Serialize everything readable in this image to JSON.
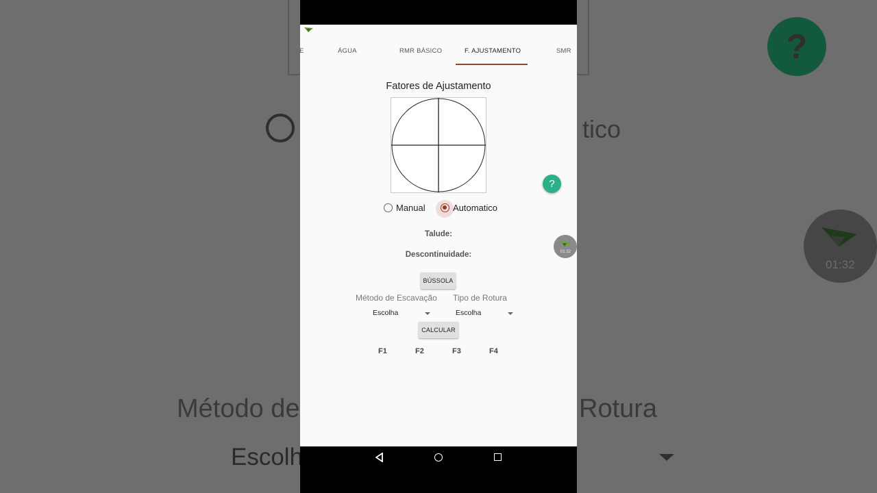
{
  "background": {
    "partial_right_text": "tico",
    "partial_label_left": "Método de",
    "partial_label_right": "Rotura",
    "partial_spinner": "Escolh",
    "help_glyph": "?",
    "recorder_time": "01:32"
  },
  "statusbar": {
    "app_icon": "paper-plane-icon"
  },
  "tabs": [
    {
      "label": "E"
    },
    {
      "label": "ÁGUA"
    },
    {
      "label": "RMR BÁSICO"
    },
    {
      "label": "F. AJUSTAMENTO",
      "active": true
    },
    {
      "label": "SMR"
    }
  ],
  "main": {
    "title": "Fatores de Ajustamento",
    "mode": {
      "options": [
        "Manual",
        "Automatico"
      ],
      "selected": "Automatico"
    },
    "talude_label": "Talude:",
    "descontinuidade_label": "Descontinuidade:",
    "bussola_button": "BÚSSOLA",
    "metodo_label": "Método de Escavação",
    "tipo_label": "Tipo de Rotura",
    "metodo_value": "Escolha",
    "tipo_value": "Escolha",
    "calcular_button": "CALCULAR",
    "factors": [
      "F1",
      "F2",
      "F3",
      "F4"
    ]
  },
  "overlay": {
    "help_glyph": "?",
    "recorder_time": "01:32"
  },
  "colors": {
    "accent": "#9b3c22",
    "tab_indicator": "#8d4a2f",
    "help_fab": "#2bb08a"
  }
}
